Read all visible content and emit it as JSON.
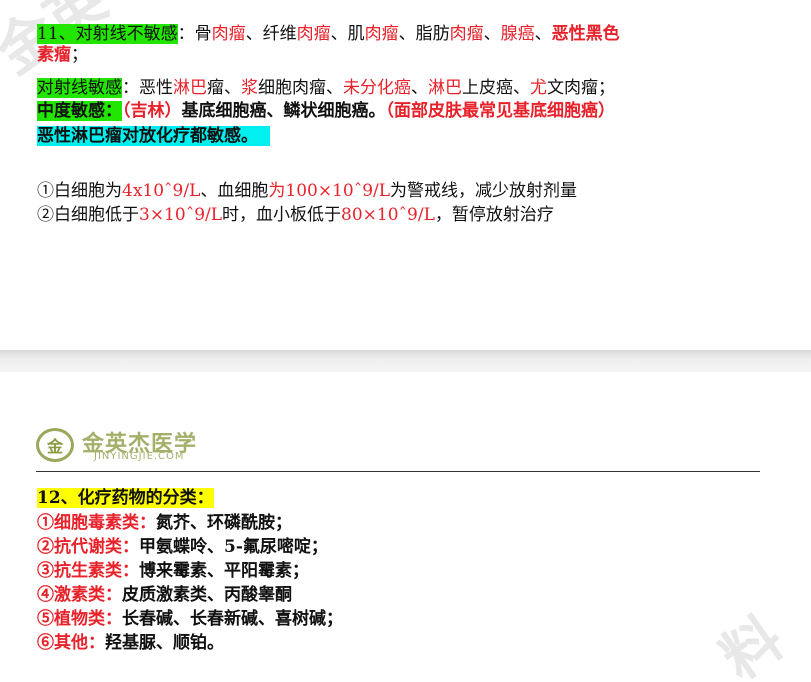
{
  "page1": {
    "watermark": "金英",
    "radio_line1": {
      "label": "11、对射线不敏感",
      "colon": "：骨",
      "r1": "肉瘤",
      "t1": "、纤维",
      "r2": "肉瘤",
      "t2": "、肌",
      "r3": "肉瘤",
      "t3": "、脂肪",
      "r4": "肉瘤",
      "t4": "、",
      "r5": "腺癌",
      "t5": "、",
      "r6": "恶性黑色"
    },
    "radio_line2": {
      "r": "素瘤",
      "t": "；"
    },
    "radio_line3": {
      "label": "对射线敏感",
      "t0": "：恶性",
      "r1": "淋巴",
      "t1": "瘤、",
      "r2": "浆",
      "t2": "细胞肉瘤、",
      "r3": "未分化癌",
      "t3": "、",
      "r4": "淋巴",
      "t4": "上皮癌、",
      "r5": "尤",
      "t5": "文肉瘤；"
    },
    "radio_line4": {
      "label": "中度敏感：",
      "r1": "（吉林）",
      "t1": "基底细胞癌、鳞状细胞癌。",
      "r2": "（面部皮肤最常见基底细胞癌）"
    },
    "radio_line5": {
      "label": "恶性淋巴瘤对放化疗都敏感。"
    },
    "wbc_line1": {
      "t0": "①白细胞为",
      "r1": "4x10ˆ9/L",
      "t1": "、血细胞",
      "r2": "为100×10ˆ9/L",
      "t2": "为警戒线，减少放射剂量"
    },
    "wbc_line2": {
      "t0": "②白细胞低于",
      "r1": "3×10ˆ9/L",
      "t1": "时，血小板低于",
      "r2": "80×10ˆ9/L",
      "t2": "，暂停放射治疗"
    }
  },
  "page2": {
    "logo": {
      "cn": "金英杰医学",
      "en": "JINYINGJIE.COM",
      "mark": "金"
    },
    "watermark": "料",
    "heading": "12、化疗药物的分类：",
    "items": [
      {
        "cat": "①细胞毒素类：",
        "drugs": "氮芥、环磷酰胺；"
      },
      {
        "cat": "②抗代谢类：",
        "drugs": "甲氨蝶呤、5-氟尿嘧啶；"
      },
      {
        "cat": "③抗生素类：",
        "drugs": "博来霉素、平阳霉素；"
      },
      {
        "cat": "④激素类：",
        "drugs": "皮质激素类、丙酸睾酮"
      },
      {
        "cat": "⑤植物类：",
        "drugs": "长春碱、长春新碱、喜树碱；"
      },
      {
        "cat": "⑥其他：",
        "drugs": "羟基脲、顺铂。"
      }
    ]
  }
}
